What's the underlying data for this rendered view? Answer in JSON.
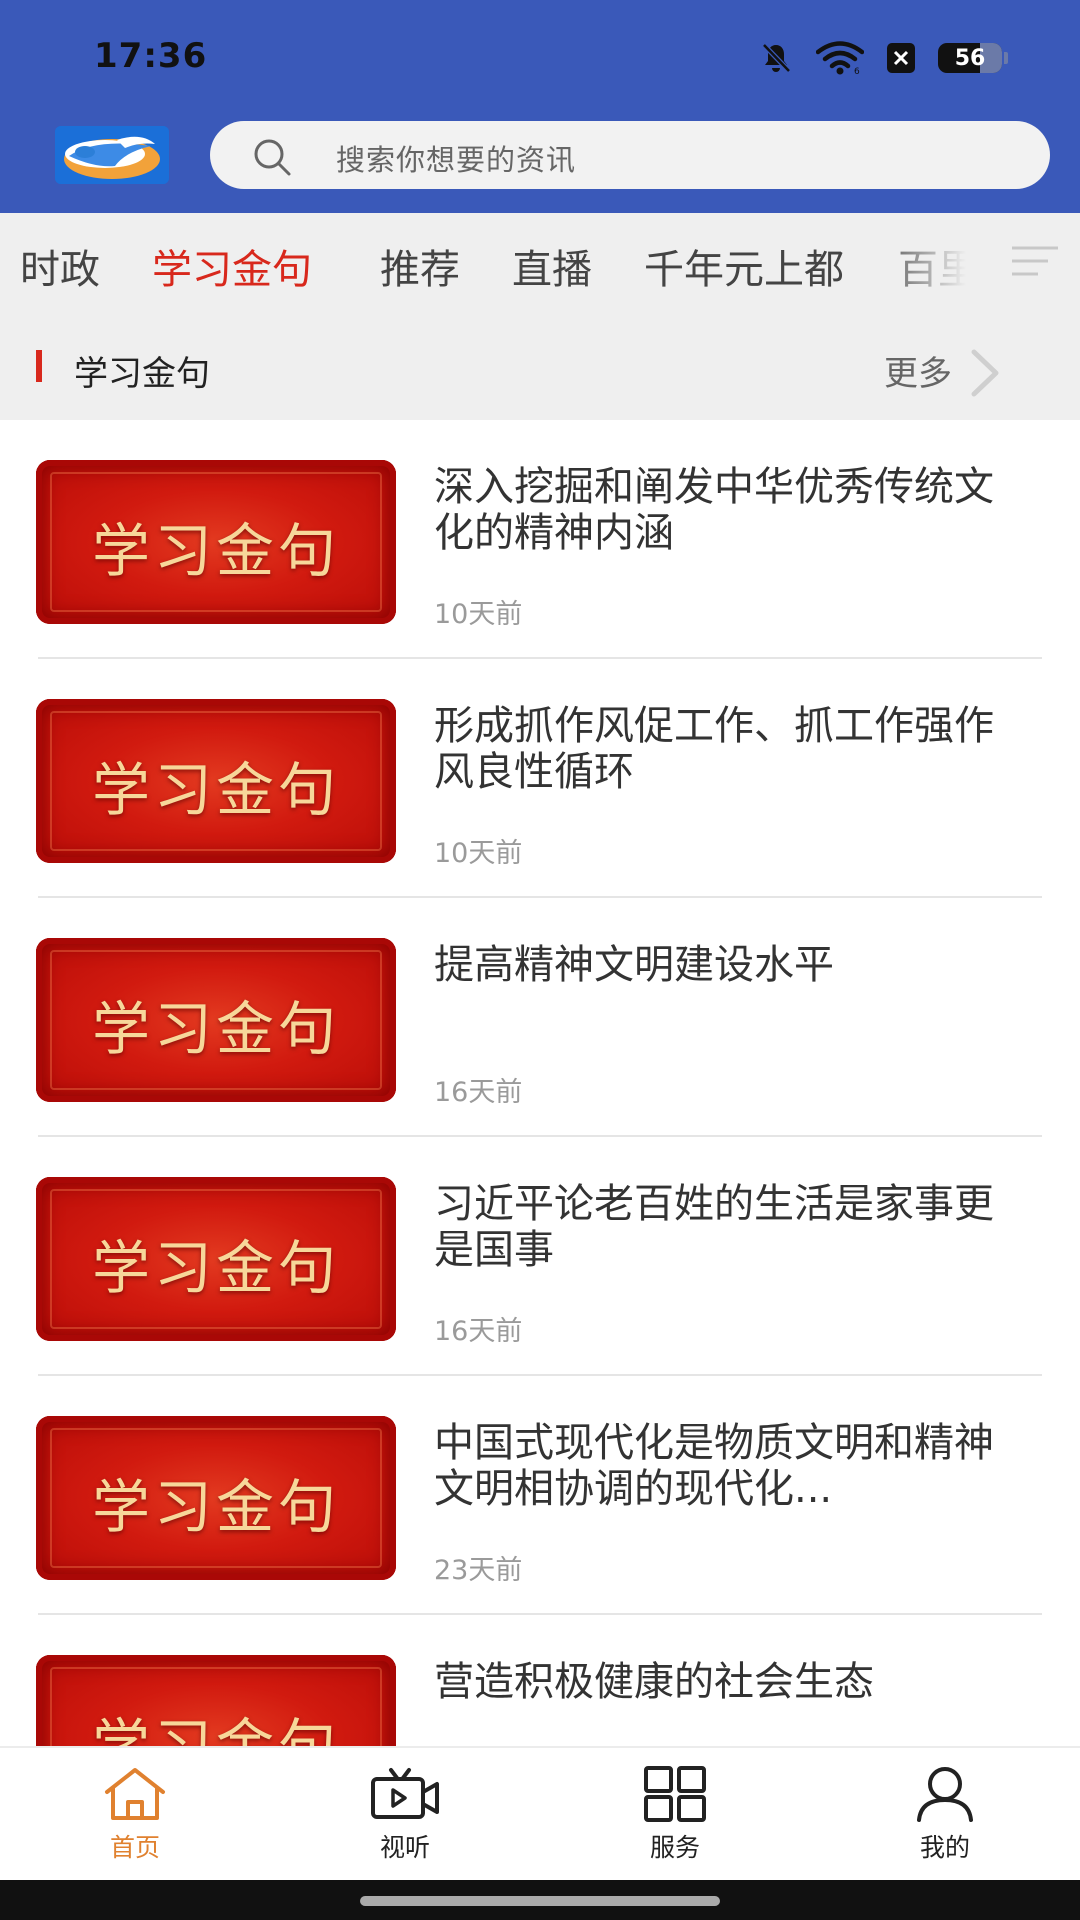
{
  "status_bar": {
    "time": "17:36",
    "battery": "56",
    "battery_level_percent": 56
  },
  "header": {
    "search": {
      "placeholder": "搜索你想要的资讯"
    }
  },
  "tabs": [
    {
      "label": "时政",
      "active": false
    },
    {
      "label": "学习金句",
      "active": true
    },
    {
      "label": "推荐",
      "active": false
    },
    {
      "label": "直播",
      "active": false
    },
    {
      "label": "千年元上都",
      "active": false
    },
    {
      "label": "百里",
      "active": false
    }
  ],
  "section": {
    "title": "学习金句",
    "more_label": "更多"
  },
  "news": [
    {
      "thumb_text": "学习金句",
      "title": "深入挖掘和阐发中华优秀传统文化的精神内涵",
      "time": "10天前"
    },
    {
      "thumb_text": "学习金句",
      "title": "形成抓作风促工作、抓工作强作风良性循环",
      "time": "10天前"
    },
    {
      "thumb_text": "学习金句",
      "title": "提高精神文明建设水平",
      "time": "16天前"
    },
    {
      "thumb_text": "学习金句",
      "title": "习近平论老百姓的生活是家事更是国事",
      "time": "16天前"
    },
    {
      "thumb_text": "学习金句",
      "title": "中国式现代化是物质文明和精神文明相协调的现代化...",
      "time": "23天前"
    },
    {
      "thumb_text": "学习金句",
      "title": "营造积极健康的社会生态",
      "time": ""
    }
  ],
  "bottom_nav": [
    {
      "label": "首页",
      "icon": "home-icon",
      "active": true
    },
    {
      "label": "视听",
      "icon": "video-icon",
      "active": false
    },
    {
      "label": "服务",
      "icon": "grid-icon",
      "active": false
    },
    {
      "label": "我的",
      "icon": "user-icon",
      "active": false
    }
  ],
  "colors": {
    "header_bg": "#3a59b9",
    "accent_red": "#d8281c",
    "nav_active": "#e0812f",
    "tab_bg": "#efefef"
  }
}
